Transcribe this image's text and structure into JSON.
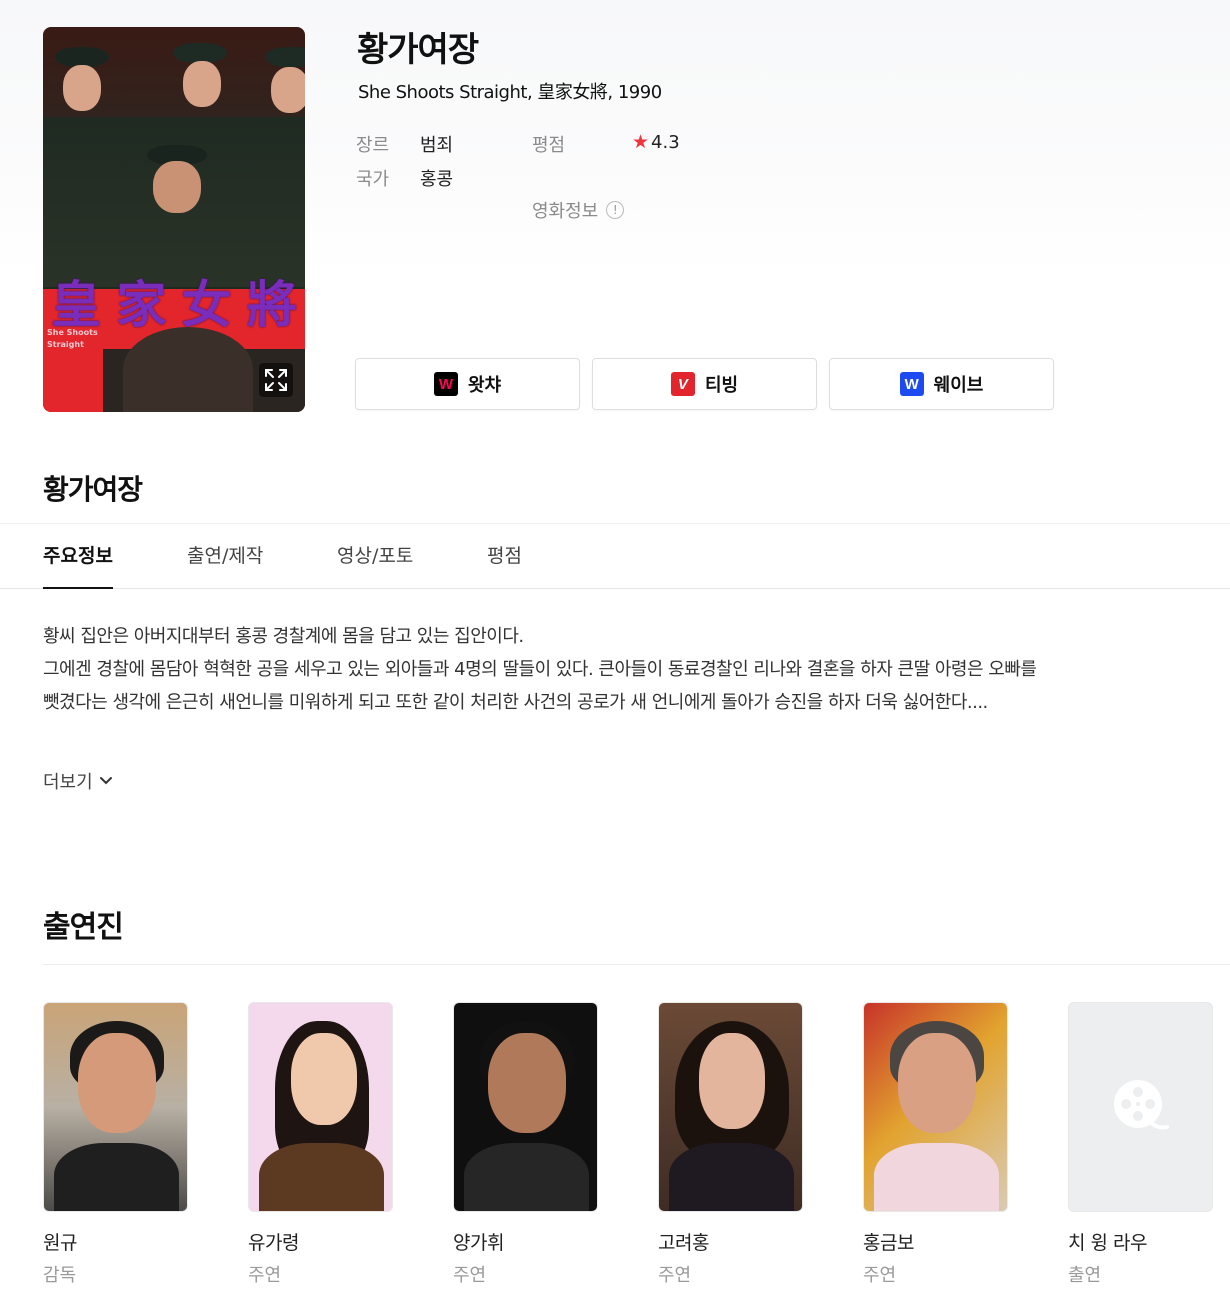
{
  "movie": {
    "title": "황가여장",
    "subtitle": "She Shoots Straight, 皇家女將, 1990",
    "poster_chars": [
      "皇",
      "家",
      "女",
      "將"
    ],
    "poster_small_title": "She Shoots Straight",
    "genre_label": "장르",
    "genre_value": "범죄",
    "country_label": "국가",
    "country_value": "홍콩",
    "rating_label": "평점",
    "rating_value": "4.3",
    "info_label": "영화정보",
    "info_icon": "!"
  },
  "ott": [
    {
      "name": "왓챠",
      "logo_letter": "W",
      "logo_color": "#ff0558",
      "logo_bg": "#000000"
    },
    {
      "name": "티빙",
      "logo_letter": "V",
      "logo_color": "#ffffff",
      "logo_bg": "#e2252d"
    },
    {
      "name": "웨이브",
      "logo_letter": "W",
      "logo_color": "#ffffff",
      "logo_bg": "#1e4bf1"
    }
  ],
  "section": {
    "title": "황가여장"
  },
  "tabs": [
    {
      "label": "주요정보",
      "active": true
    },
    {
      "label": "출연/제작",
      "active": false
    },
    {
      "label": "영상/포토",
      "active": false
    },
    {
      "label": "평점",
      "active": false
    }
  ],
  "synopsis": {
    "line1": "황씨 집안은 아버지대부터 홍콩 경찰계에 몸을 담고 있는 집안이다.",
    "line2": "그에겐 경찰에 몸담아 혁혁한 공을 세우고 있는 외아들과 4명의 딸들이 있다. 큰아들이 동료경찰인 리나와 결혼을 하자 큰딸 아령은 오빠를 뺏겼다는 생각에 은근히 새언니를 미워하게 되고 또한 같이 처리한 사건의 공로가 새 언니에게 돌아가 승진을 하자 더욱 싫어한다....",
    "more_label": "더보기"
  },
  "cast": {
    "title": "출연진",
    "members": [
      {
        "name": "원규",
        "role": "감독"
      },
      {
        "name": "유가령",
        "role": "주연"
      },
      {
        "name": "양가휘",
        "role": "주연"
      },
      {
        "name": "고려홍",
        "role": "주연"
      },
      {
        "name": "홍금보",
        "role": "주연"
      },
      {
        "name": "치 윙 라우",
        "role": "출연"
      }
    ]
  },
  "colors": {
    "star": "#f0353f",
    "poster_red": "#e3262b"
  }
}
